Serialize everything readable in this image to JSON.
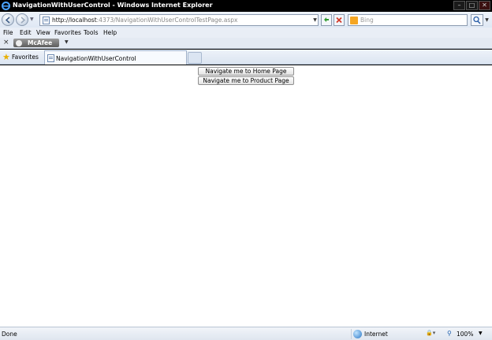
{
  "window": {
    "title": "NavigationWithUserControl - Windows Internet Explorer",
    "controls": {
      "minimize": "–",
      "maximize": "□",
      "close": "✕"
    }
  },
  "address_bar": {
    "url_host": "http://localhost",
    "url_rest": ":4373/NavigationWithUserControlTestPage.aspx",
    "search_placeholder": "Bing"
  },
  "menu": {
    "items": [
      "File",
      "Edit",
      "View",
      "Favorites",
      "Tools",
      "Help"
    ]
  },
  "toolbar": {
    "mcafee_label": "McAfee"
  },
  "favorites_bar": {
    "favorites_label": "Favorites",
    "tab_title": "NavigationWithUserControl"
  },
  "content": {
    "home_button_label": "Navigate me to Home Page",
    "product_button_label": "Navigate me to Product Page"
  },
  "status_bar": {
    "status": "Done",
    "zone": "Internet",
    "zoom": "100%"
  },
  "icons": [
    "ie-logo-icon",
    "back-icon",
    "forward-icon",
    "page-icon",
    "refresh-icon",
    "stop-icon",
    "bing-icon",
    "search-icon",
    "favorites-star-icon",
    "globe-icon",
    "zoom-icon"
  ],
  "colors": {
    "title_bar": "#000000",
    "content_bg": "#ffffff",
    "chrome_bg": "#e4eaf3"
  }
}
